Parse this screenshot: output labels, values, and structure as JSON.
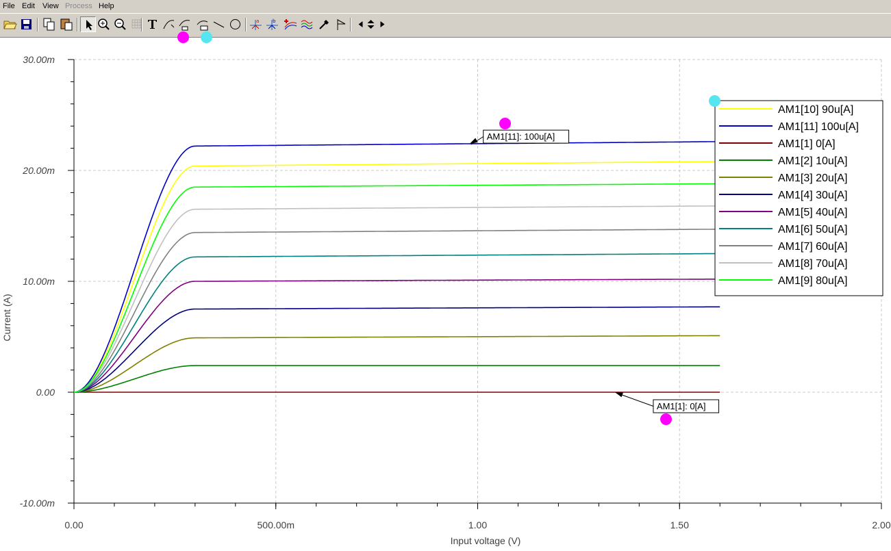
{
  "menu": {
    "file": "File",
    "edit": "Edit",
    "view": "View",
    "process": "Process",
    "help": "Help"
  },
  "toolbar": {
    "buttons": [
      "open-icon",
      "save-icon",
      "copy-icon",
      "paste-icon",
      "pointer-icon",
      "zoom-in-icon",
      "zoom-out-icon",
      "grid-icon",
      "text-icon",
      "curve-icon",
      "curve-marked-icon",
      "curve-label-icon",
      "line-icon",
      "circle-icon",
      "cursor-a-icon",
      "cursor-b-icon",
      "add-curve-icon",
      "waves-icon",
      "probe-icon",
      "flag-icon",
      "arrow-left-icon",
      "arrow-up-down-icon",
      "arrow-right-icon"
    ]
  },
  "colors": {
    "marker_magenta": "#ff00ff",
    "marker_cyan": "#55e6f0",
    "axis_text": "#404040"
  },
  "chart_data": {
    "type": "line",
    "xlabel": "Input voltage (V)",
    "ylabel": "Current (A)",
    "xlim": [
      0,
      2.0
    ],
    "ylim": [
      -0.01,
      0.03
    ],
    "x_ticks": [
      {
        "value": 0,
        "label": "0.00"
      },
      {
        "value": 0.5,
        "label": "500.00m"
      },
      {
        "value": 1.0,
        "label": "1.00"
      },
      {
        "value": 1.5,
        "label": "1.50"
      },
      {
        "value": 2.0,
        "label": "2.00"
      }
    ],
    "y_ticks": [
      {
        "value": 0.03,
        "label": "30.00m"
      },
      {
        "value": 0.02,
        "label": "20.00m"
      },
      {
        "value": 0.01,
        "label": "10.00m"
      },
      {
        "value": 0,
        "label": "0.00"
      },
      {
        "value": -0.01,
        "label": "-10.00m"
      }
    ],
    "grid": true,
    "legend_position": "top-right",
    "x_end": 1.6,
    "knee_voltage": 0.3,
    "series": [
      {
        "name": "AM1[10]  90u[A]",
        "color": "#ffff00",
        "saturation": 0.0204,
        "end": 0.0208
      },
      {
        "name": "AM1[11]  100u[A]",
        "color": "#0000cc",
        "saturation": 0.0222,
        "end": 0.0226
      },
      {
        "name": "AM1[1]  0[A]",
        "color": "#800000",
        "saturation": 0,
        "end": 0
      },
      {
        "name": "AM1[2]  10u[A]",
        "color": "#008000",
        "saturation": 0.0024,
        "end": 0.0024
      },
      {
        "name": "AM1[3]  20u[A]",
        "color": "#808000",
        "saturation": 0.0049,
        "end": 0.0051
      },
      {
        "name": "AM1[4]  30u[A]",
        "color": "#000080",
        "saturation": 0.0075,
        "end": 0.0077
      },
      {
        "name": "AM1[5]  40u[A]",
        "color": "#800080",
        "saturation": 0.01,
        "end": 0.0102
      },
      {
        "name": "AM1[6]  50u[A]",
        "color": "#008080",
        "saturation": 0.0122,
        "end": 0.0125
      },
      {
        "name": "AM1[7]  60u[A]",
        "color": "#808080",
        "saturation": 0.0144,
        "end": 0.0147
      },
      {
        "name": "AM1[8]  70u[A]",
        "color": "#c0c0c0",
        "saturation": 0.0165,
        "end": 0.0168
      },
      {
        "name": "AM1[9]  80u[A]",
        "color": "#00ff00",
        "saturation": 0.0185,
        "end": 0.0188
      }
    ],
    "annotations": [
      {
        "text": "AM1[11]: 100u[A]",
        "x": 0.98,
        "y": 0.0224
      },
      {
        "text": "AM1[1]: 0[A]",
        "x": 1.34,
        "y": 0
      }
    ]
  }
}
